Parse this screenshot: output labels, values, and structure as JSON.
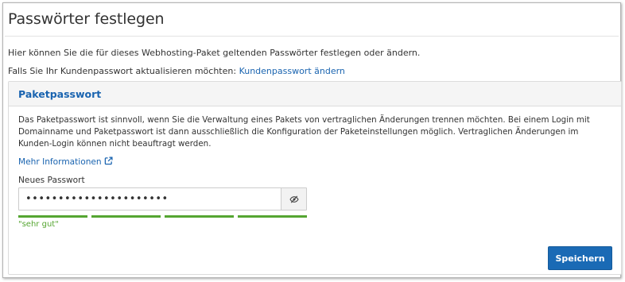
{
  "page": {
    "title": "Passwörter festlegen",
    "intro": "Hier können Sie die für dieses Webhosting-Paket geltenden Passwörter festlegen oder ändern.",
    "customer_prompt": "Falls Sie Ihr Kundenpasswort aktualisieren möchten:",
    "customer_link": "Kundenpasswort ändern"
  },
  "panel": {
    "header": "Paketpasswort",
    "description": "Das Paketpasswort ist sinnvoll, wenn Sie die Verwaltung eines Pakets von vertraglichen Änderungen trennen möchten. Bei einem Login mit Domainname und Paketpasswort ist dann ausschließlich die Konfiguration der Paketeinstellungen möglich. Vertraglichen Änderungen im Kunden-Login können nicht beauftragt werden.",
    "more_info_link": "Mehr Informationen",
    "more_info_icon": "external-link-icon",
    "password_label": "Neues Passwort",
    "password_value": "••••••••••••••••••••••",
    "toggle_icon": "eye-slash-icon",
    "strength": {
      "level": 4,
      "max": 4,
      "label": "\"sehr gut\"",
      "color": "#55a531"
    },
    "save_label": "Speichern"
  },
  "colors": {
    "link": "#1a64b0",
    "primary_button": "#1a6ab5",
    "strength_good": "#55a531"
  }
}
